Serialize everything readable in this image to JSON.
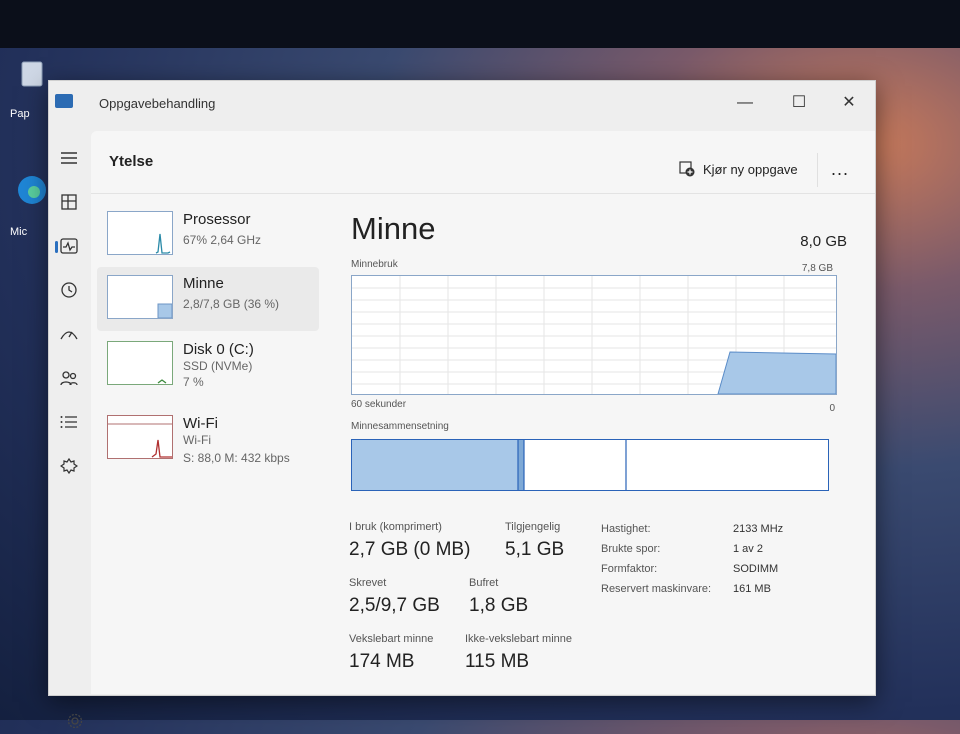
{
  "desktop": {
    "icon1_label": "Pap",
    "icon2_label": "Mic"
  },
  "window": {
    "title": "Oppgavebehandling",
    "minimize": "—",
    "maximize": "☐",
    "close": "✕"
  },
  "nav": {
    "items": [
      "menu-icon",
      "processes-icon",
      "performance-icon",
      "app-history-icon",
      "startup-icon",
      "users-icon",
      "details-icon",
      "services-icon"
    ],
    "settings_icon": "gear-icon"
  },
  "header": {
    "page_title": "Ytelse",
    "run_new_task": "Kjør ny oppgave",
    "more": "..."
  },
  "resources": [
    {
      "name": "Prosessor",
      "sub1": "67% 2,64 GHz",
      "sub2": ""
    },
    {
      "name": "Minne",
      "sub1": "2,8/7,8 GB (36 %)",
      "sub2": ""
    },
    {
      "name": "Disk 0 (C:)",
      "sub1": "SSD (NVMe)",
      "sub2": "7 %"
    },
    {
      "name": "Wi-Fi",
      "sub1": "Wi-Fi",
      "sub2": "S: 88,0 M: 432 kbps"
    }
  ],
  "memory": {
    "title": "Minne",
    "total": "8,0 GB",
    "usage_label": "Minnebruk",
    "usage_max": "7,8 GB",
    "time_label": "60 sekunder",
    "time_zero": "0",
    "composition_label": "Minnesammensetning",
    "stats": {
      "in_use_label": "I bruk (komprimert)",
      "in_use_value": "2,7 GB (0 MB)",
      "available_label": "Tilgjengelig",
      "available_value": "5,1 GB",
      "committed_label": "Skrevet",
      "committed_value": "2,5/9,7 GB",
      "cached_label": "Bufret",
      "cached_value": "1,8 GB",
      "paged_label": "Vekslebart minne",
      "paged_value": "174 MB",
      "nonpaged_label": "Ikke-vekslebart minne",
      "nonpaged_value": "115 MB"
    },
    "details": [
      {
        "label": "Hastighet:",
        "value": "2133 MHz"
      },
      {
        "label": "Brukte spor:",
        "value": "1 av 2"
      },
      {
        "label": "Formfaktor:",
        "value": "SODIMM"
      },
      {
        "label": "Reservert maskinvare:",
        "value": "161 MB"
      }
    ]
  },
  "colors": {
    "accent": "#2a63b8",
    "graph_fill": "#a8c8e8",
    "graph_border": "#8aa6c8"
  }
}
